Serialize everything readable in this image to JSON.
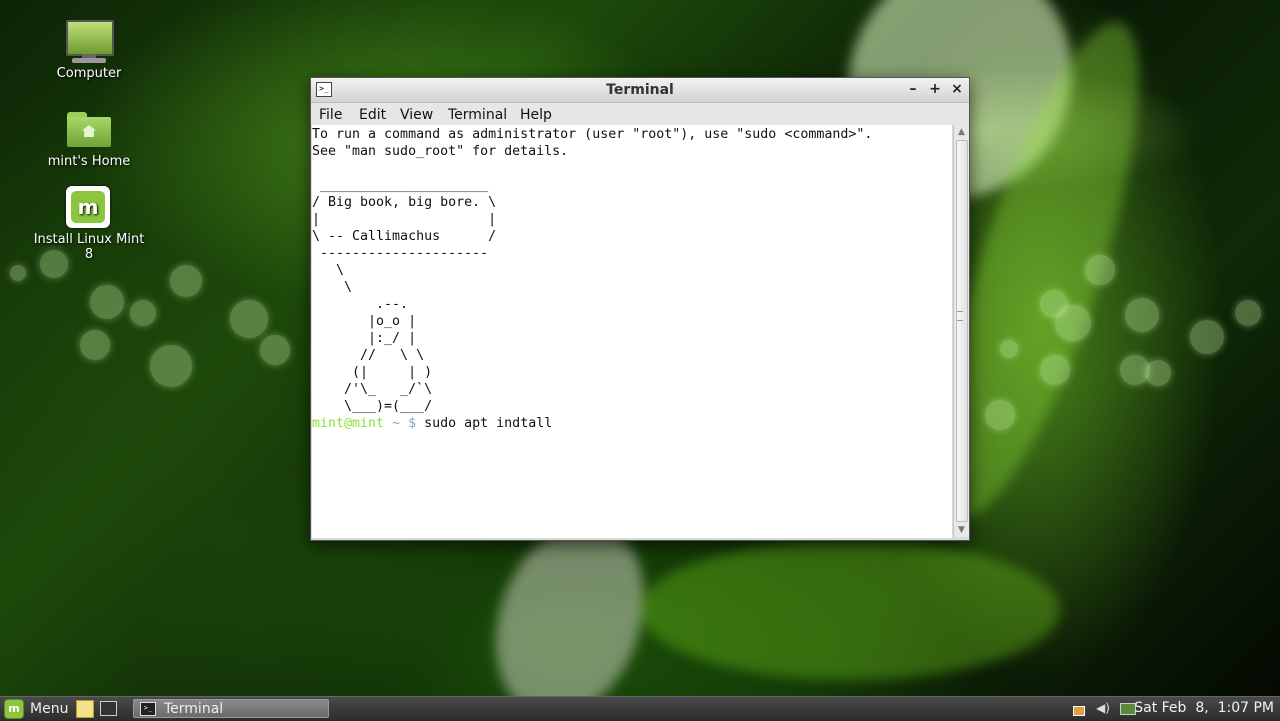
{
  "desktop": {
    "icons": [
      {
        "label": "Computer",
        "icon": "computer-icon"
      },
      {
        "label": "mint's Home",
        "icon": "home-folder-icon"
      },
      {
        "label": "Install Linux Mint 8",
        "icon": "mint-installer-icon"
      }
    ]
  },
  "window": {
    "title": "Terminal",
    "controls": {
      "minimize": "–",
      "maximize": "+",
      "close": "×"
    },
    "menu": [
      "File",
      "Edit",
      "View",
      "Terminal",
      "Help"
    ],
    "terminal": {
      "lines": [
        "To run a command as administrator (user \"root\"), use \"sudo <command>\".",
        "See \"man sudo_root\" for details.",
        "",
        " _____________________",
        "/ Big book, big bore. \\",
        "|                     |",
        "\\ -- Callimachus      /",
        " ---------------------",
        "   \\",
        "    \\",
        "        .--.",
        "       |o_o |",
        "       |:_/ |",
        "      //   \\ \\",
        "     (|     | )",
        "    /'\\_   _/`\\",
        "    \\___)=(___/",
        ""
      ],
      "prompt_user": "mint@mint",
      "prompt_path": "~ $",
      "command": "sudo apt indtall"
    }
  },
  "panel": {
    "menu_label": "Menu",
    "task_label": "Terminal",
    "clock": "Sat Feb  8,  1:07 PM",
    "tray_icons": [
      "update-manager-icon",
      "volume-icon",
      "network-icon"
    ]
  },
  "colors": {
    "prompt_user": "#8ae234",
    "prompt_path": "#7aa6d6",
    "mint_green": "#8cc63f"
  }
}
